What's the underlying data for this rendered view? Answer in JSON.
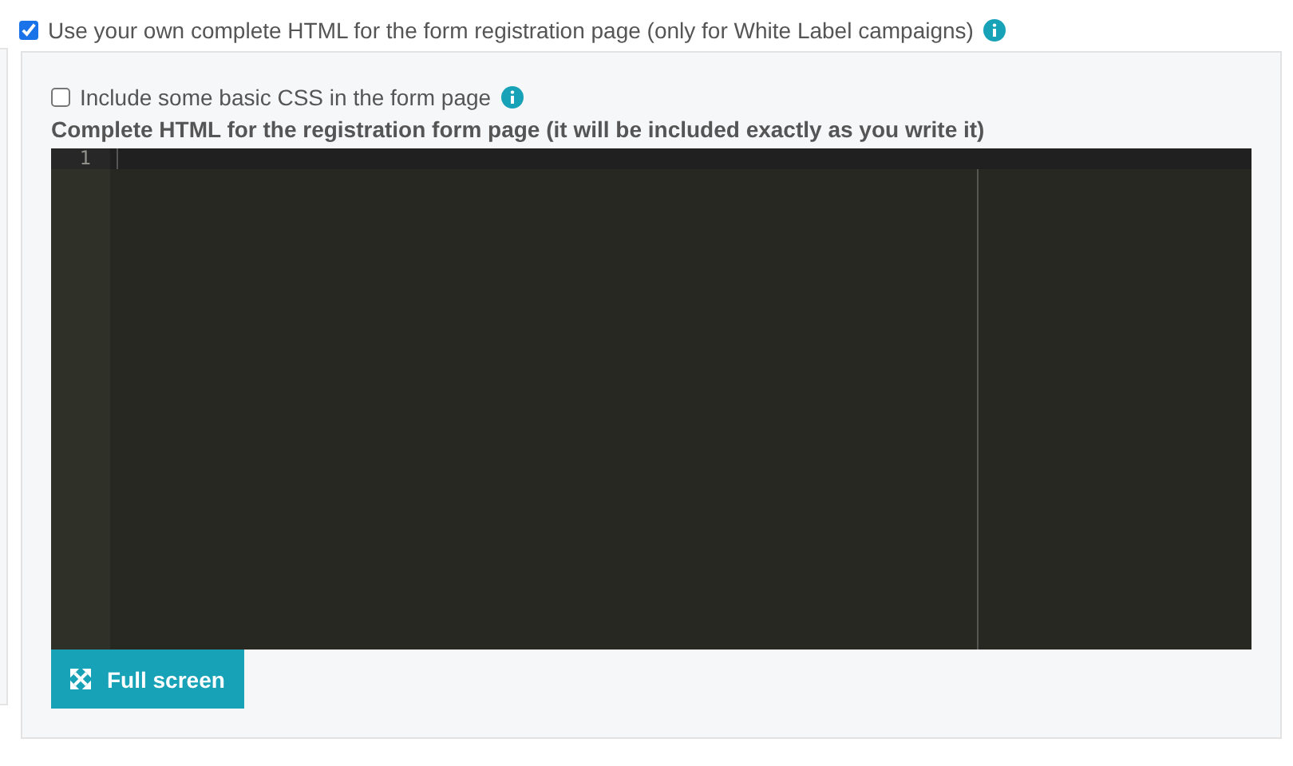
{
  "custom_html_option": {
    "label": "Use your own complete HTML for the form registration page (only for White Label campaigns)",
    "checked": true
  },
  "basic_css_option": {
    "label": "Include some basic CSS in the form page",
    "checked": false
  },
  "editor": {
    "label": "Complete HTML for the registration form page (it will be included exactly as you write it)",
    "line_numbers": [
      "1"
    ]
  },
  "fullscreen_button": {
    "label": "Full screen"
  }
}
